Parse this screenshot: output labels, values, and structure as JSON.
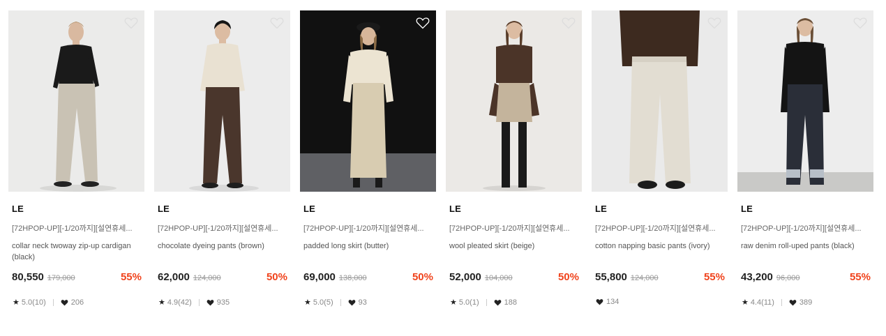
{
  "colors": {
    "discount": "#f0431c",
    "background": "#ffffff"
  },
  "icons": {
    "wishlist": "heart-outline-icon",
    "rating": "star-icon",
    "likes": "heart-filled-icon"
  },
  "products": [
    {
      "brand": "LE",
      "promo": "[72HPOP-UP][-1/20까지][설연휴세...",
      "name": "collar neck twoway zip-up cardigan (black)",
      "price": "80,550",
      "original_price": "179,000",
      "discount": "55%",
      "rating": "5.0(10)",
      "likes": "206"
    },
    {
      "brand": "LE",
      "promo": "[72HPOP-UP][-1/20까지][설연휴세...",
      "name": "chocolate dyeing pants (brown)",
      "price": "62,000",
      "original_price": "124,000",
      "discount": "50%",
      "rating": "4.9(42)",
      "likes": "935"
    },
    {
      "brand": "LE",
      "promo": "[72HPOP-UP][-1/20까지][설연휴세...",
      "name": "padded long skirt (butter)",
      "price": "69,000",
      "original_price": "138,000",
      "discount": "50%",
      "rating": "5.0(5)",
      "likes": "93"
    },
    {
      "brand": "LE",
      "promo": "[72HPOP-UP][-1/20까지][설연휴세...",
      "name": "wool pleated skirt (beige)",
      "price": "52,000",
      "original_price": "104,000",
      "discount": "50%",
      "rating": "5.0(1)",
      "likes": "188"
    },
    {
      "brand": "LE",
      "promo": "[72HPOP-UP][-1/20까지][설연휴세...",
      "name": "cotton napping basic pants (ivory)",
      "price": "55,800",
      "original_price": "124,000",
      "discount": "55%",
      "rating": "",
      "likes": "134"
    },
    {
      "brand": "LE",
      "promo": "[72HPOP-UP][-1/20까지][설연휴세...",
      "name": "raw denim roll-uped pants (black)",
      "price": "43,200",
      "original_price": "96,000",
      "discount": "55%",
      "rating": "4.4(11)",
      "likes": "389"
    }
  ]
}
